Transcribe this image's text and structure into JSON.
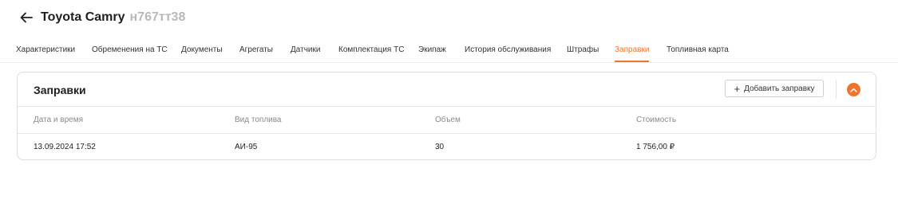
{
  "header": {
    "title": "Toyota Camry",
    "plate": "н767тт38"
  },
  "tabs": [
    {
      "label": "Характеристики"
    },
    {
      "label": "Обременения на ТС"
    },
    {
      "label": "Документы"
    },
    {
      "label": "Агрегаты"
    },
    {
      "label": "Датчики"
    },
    {
      "label": "Комплектация ТС"
    },
    {
      "label": "Экипаж"
    },
    {
      "label": "История обслуживания"
    },
    {
      "label": "Штрафы"
    },
    {
      "label": "Заправки",
      "active": true
    },
    {
      "label": "Топливная карта"
    }
  ],
  "card": {
    "title": "Заправки",
    "add_button_label": "Добавить заправку",
    "columns": [
      "Дата и время",
      "Вид топлива",
      "Объем",
      "Стоимость"
    ],
    "rows": [
      [
        "13.09.2024 17:52",
        "АИ-95",
        "30",
        "1 756,00 ₽"
      ]
    ]
  },
  "colors": {
    "accent": "#f0752c",
    "muted_text": "#8a8a8a",
    "border": "#dedede"
  },
  "icons": {
    "back": "arrow-left-icon",
    "add": "plus-icon",
    "collapse": "chevron-up-icon"
  }
}
